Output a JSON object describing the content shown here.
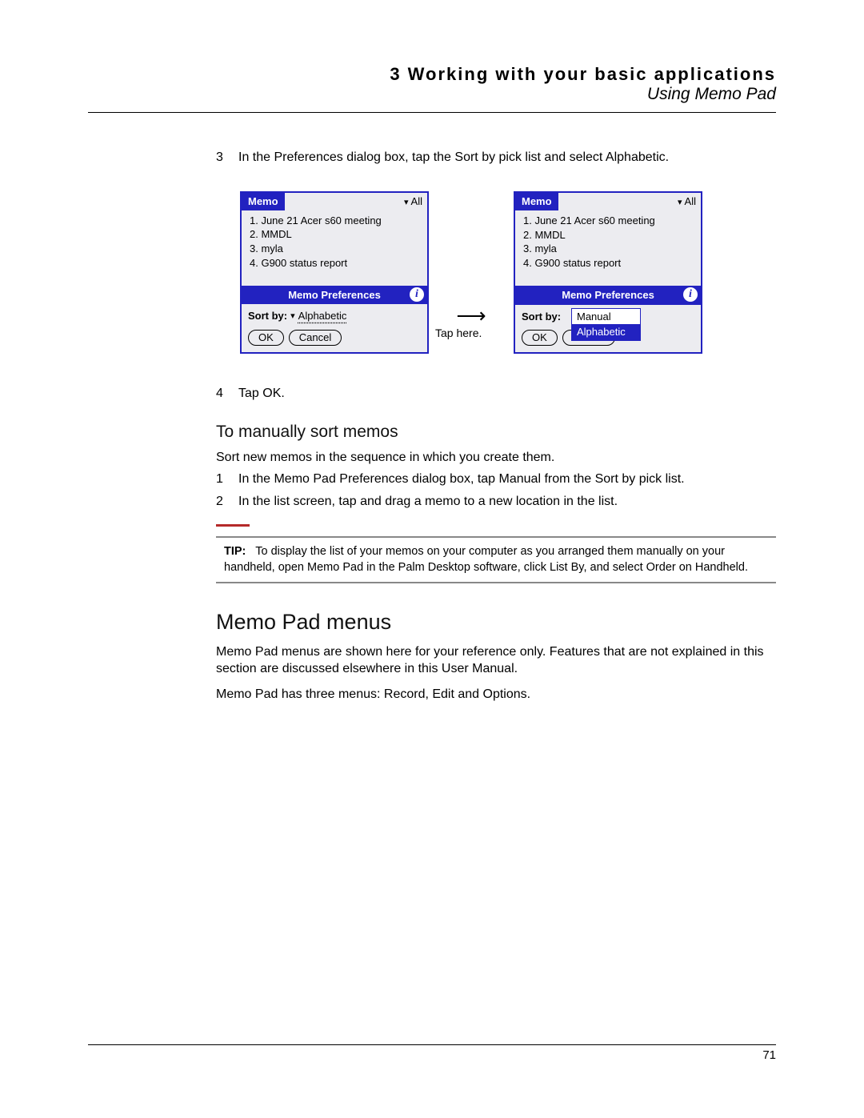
{
  "header": {
    "chapter_line": "3 Working with your basic applications",
    "section_line": "Using Memo Pad"
  },
  "steps_a": [
    {
      "num": "3",
      "text": "In the Preferences dialog box, tap the Sort by pick list and select Alphabetic."
    }
  ],
  "figure": {
    "left": {
      "app_title": "Memo",
      "category": "All",
      "list": [
        "1.  June 21 Acer s60 meeting",
        "2.  MMDL",
        "3.  myla",
        "4.  G900 status report"
      ],
      "pref_title": "Memo Preferences",
      "sort_label": "Sort by:",
      "sort_value": "Alphabetic",
      "ok": "OK",
      "cancel": "Cancel"
    },
    "callout": "Tap here.",
    "right": {
      "app_title": "Memo",
      "category": "All",
      "list": [
        "1.  June 21 Acer s60 meeting",
        "2.  MMDL",
        "3.  myla",
        "4.  G900 status report"
      ],
      "pref_title": "Memo Preferences",
      "sort_label": "Sort by:",
      "options": [
        "Manual",
        "Alphabetic"
      ],
      "selected_index": 1,
      "ok": "OK",
      "cancel": "Cancel"
    }
  },
  "steps_b": [
    {
      "num": "4",
      "text": "Tap OK."
    }
  ],
  "subheading": "To manually sort memos",
  "sub_intro": "Sort new memos in the sequence in which you create them.",
  "sub_steps": [
    {
      "num": "1",
      "text": "In the Memo Pad Preferences dialog box, tap Manual from the Sort by pick list."
    },
    {
      "num": "2",
      "text": "In the list screen, tap and drag a memo to a new location in the list."
    }
  ],
  "tip": {
    "label": "TIP:",
    "text": "To display the list of your memos on your computer as you arranged them manually on your handheld, open Memo Pad in the Palm Desktop software, click List By, and select Order on Handheld."
  },
  "section2": {
    "title": "Memo Pad menus",
    "para1": "Memo Pad menus are shown here for your reference only. Features that are not explained in this section are discussed elsewhere in this User Manual.",
    "para2": "Memo Pad has three menus: Record, Edit and Options."
  },
  "page_number": "71"
}
